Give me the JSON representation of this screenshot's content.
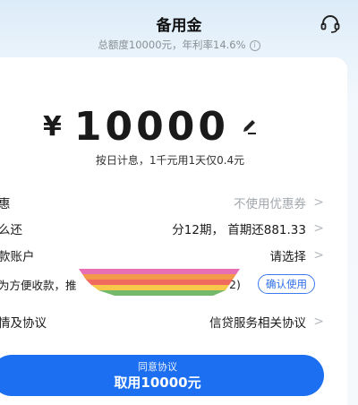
{
  "header": {
    "title": "备用金",
    "subtitle_total": "总额度10000元，",
    "subtitle_rate": "年利率14.6%",
    "info_glyph": "i"
  },
  "amount": {
    "currency": "¥",
    "value": "10000",
    "note": "按日计息，1千元用1天仅0.4元"
  },
  "rows": {
    "discount": {
      "label": "惠",
      "value": "不使用优惠券"
    },
    "repay": {
      "label": "么还",
      "value": "分12期，  首期还881.33"
    },
    "account": {
      "label": "款账户",
      "value": "请选择"
    },
    "tip": {
      "label": "为方便收款，",
      "label_tail": "推",
      "mid_tail": "2)",
      "button": "确认使用"
    },
    "agreement": {
      "label": "情及协议",
      "value": "信贷服务相关协议"
    }
  },
  "cta": {
    "sub": "同意协议",
    "main": "取用10000元"
  },
  "colors": {
    "accent": "#1c6ff0",
    "link": "#2f6fe8"
  },
  "icons": {
    "support": "headset-icon",
    "edit": "pencil-icon",
    "chevron": "chevron-right-icon",
    "info": "info-icon"
  }
}
